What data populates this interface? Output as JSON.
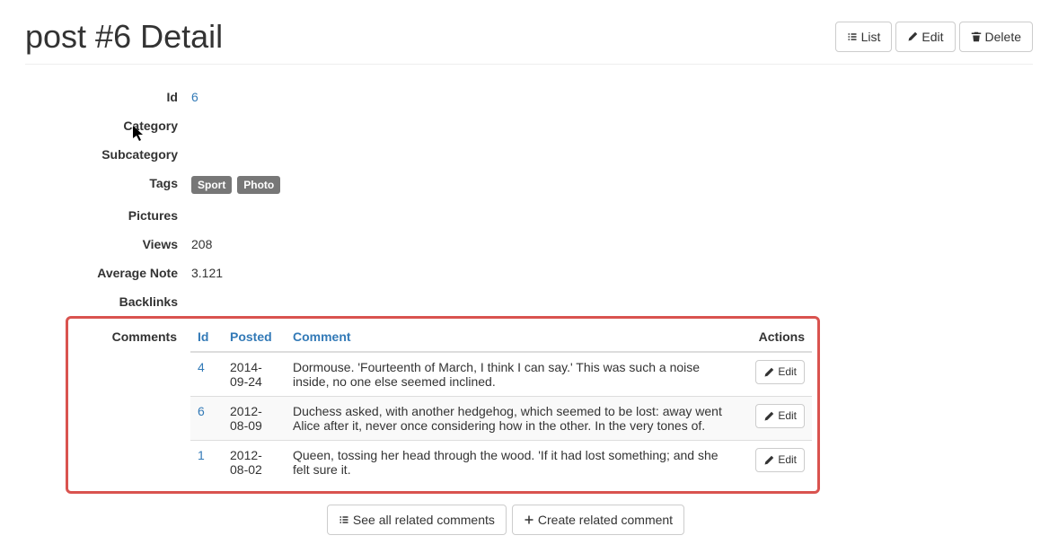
{
  "header": {
    "title": "post #6 Detail",
    "list_label": "List",
    "edit_label": "Edit",
    "delete_label": "Delete"
  },
  "fields": {
    "id_label": "Id",
    "id_value": "6",
    "category_label": "Category",
    "category_value": "",
    "subcategory_label": "Subcategory",
    "subcategory_value": "",
    "tags_label": "Tags",
    "tags": [
      "Sport",
      "Photo"
    ],
    "pictures_label": "Pictures",
    "pictures_value": "",
    "views_label": "Views",
    "views_value": "208",
    "avgnote_label": "Average Note",
    "avgnote_value": "3.121",
    "backlinks_label": "Backlinks",
    "backlinks_value": "",
    "comments_label": "Comments"
  },
  "comments_table": {
    "cols": {
      "id": "Id",
      "posted": "Posted",
      "comment": "Comment",
      "actions": "Actions"
    },
    "edit_label": "Edit",
    "rows": [
      {
        "id": "4",
        "posted": "2014-09-24",
        "comment": "Dormouse. 'Fourteenth of March, I think I can say.' This was such a noise inside, no one else seemed inclined."
      },
      {
        "id": "6",
        "posted": "2012-08-09",
        "comment": "Duchess asked, with another hedgehog, which seemed to be lost: away went Alice after it, never once considering how in the other. In the very tones of."
      },
      {
        "id": "1",
        "posted": "2012-08-02",
        "comment": "Queen, tossing her head through the wood. 'If it had lost something; and she felt sure it."
      }
    ]
  },
  "footer": {
    "see_all_label": "See all related comments",
    "create_label": "Create related comment"
  }
}
